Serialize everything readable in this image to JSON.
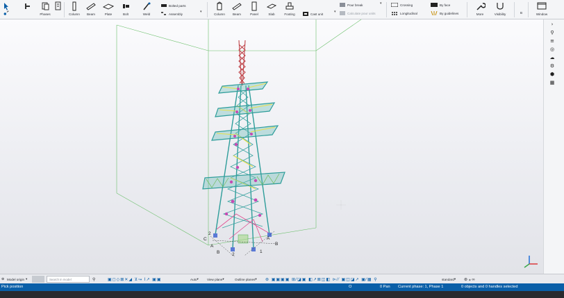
{
  "ribbon": {
    "items": [
      {
        "label": "Phases",
        "icon": "phases-icon"
      },
      {
        "label": "Column",
        "icon": "column-icon"
      },
      {
        "label": "Beam",
        "icon": "beam-icon"
      },
      {
        "label": "Plate",
        "icon": "plate-icon"
      },
      {
        "label": "Bolt",
        "icon": "bolt-icon"
      },
      {
        "label": "Weld",
        "icon": "weld-icon"
      },
      {
        "label": "Column",
        "icon": "concrete-column-icon"
      },
      {
        "label": "Beam",
        "icon": "concrete-beam-icon"
      },
      {
        "label": "Panel",
        "icon": "panel-icon"
      },
      {
        "label": "Slab",
        "icon": "slab-icon"
      },
      {
        "label": "Footing",
        "icon": "footing-icon"
      },
      {
        "label": "More",
        "icon": "more-icon"
      },
      {
        "label": "Visibility",
        "icon": "visibility-icon"
      },
      {
        "label": "Window",
        "icon": "window-icon"
      }
    ],
    "rows": {
      "bolted_parts": "Bolted parts",
      "assembly": "Assembly",
      "cast_unit": "Cast unit",
      "pour_break": "Pour break",
      "calculate_pour_units": "Calculate pour units",
      "crossing": "Crossing",
      "longitudinal": "Longitudinal",
      "by_face": "By face",
      "by_guidelines": "By guidelines",
      "b_label": "B"
    }
  },
  "bottombar": {
    "model_origin": "Model origin",
    "search_placeholder": "Search in model",
    "auto": "Auto",
    "view_plane": "View plane",
    "outline_planes": "Outline planes",
    "standard": "standard"
  },
  "statusbar": {
    "prompt": "Pick position",
    "o_label": "O",
    "pan": "0 Pan",
    "phase": "Current phase: 1, Phase 1",
    "selection": "0 objects and 0 handles selected"
  },
  "viewport": {
    "grid_labels": [
      "2",
      "C",
      "A",
      "B",
      "1",
      "2",
      "A",
      "B"
    ]
  },
  "colors": {
    "status_blue": "#0a5fa8",
    "ribbon_bg": "#f4f5f7",
    "grid_green": "#4caf50",
    "tower_teal": "#2a8f8f",
    "tower_magenta": "#c64bb4",
    "tower_yellow": "#e8e04a"
  }
}
